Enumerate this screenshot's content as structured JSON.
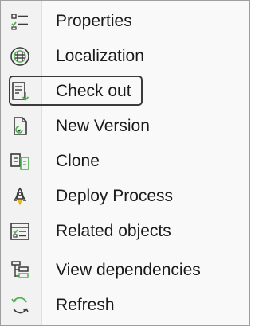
{
  "menu": {
    "items": [
      {
        "label": "Properties",
        "icon": "properties-icon"
      },
      {
        "label": "Localization",
        "icon": "globe-icon"
      },
      {
        "label": "Check out",
        "icon": "checkout-icon",
        "focused": true
      },
      {
        "label": "New Version",
        "icon": "new-version-icon"
      },
      {
        "label": "Clone",
        "icon": "clone-icon"
      },
      {
        "label": "Deploy Process",
        "icon": "rocket-icon"
      },
      {
        "label": "Related objects",
        "icon": "related-objects-icon"
      },
      {
        "label": "View dependencies",
        "icon": "tree-icon"
      },
      {
        "label": "Refresh",
        "icon": "refresh-icon"
      }
    ]
  },
  "colors": {
    "icon_dark": "#3a3a3a",
    "icon_green": "#4caf50",
    "icon_yellow": "#f0c419"
  }
}
